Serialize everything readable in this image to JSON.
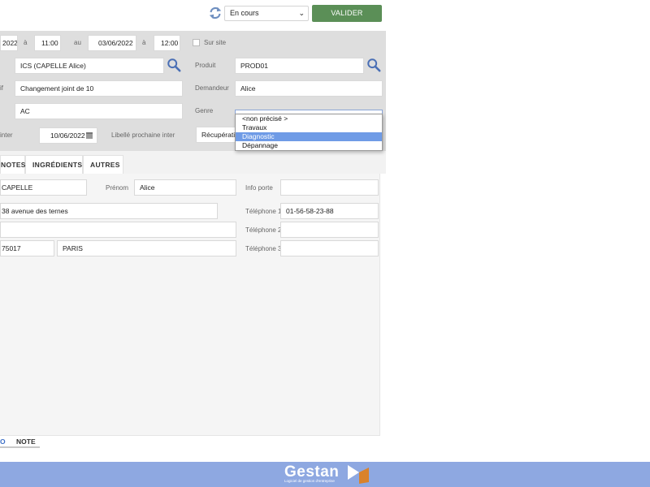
{
  "header": {
    "status_value": "En cours",
    "validate_label": "VALIDER"
  },
  "dates": {
    "start_date": "2022",
    "a1": "à",
    "start_time": "11:00",
    "au": "au",
    "end_date": "03/06/2022",
    "a2": "à",
    "end_time": "12:00",
    "sur_site": "Sur site"
  },
  "form": {
    "client_value": "ICS (CAPELLE Alice)",
    "produit_label": "Produit",
    "produit_value": "PROD01",
    "motif_label": "if",
    "motif_value": "Changement joint de 10",
    "demandeur_label": "Demandeur",
    "demandeur_value": "Alice",
    "ac_value": "AC",
    "genre_label": "Genre",
    "inter_label": "inter",
    "inter_date": "10/06/2022",
    "libelle_label": "Libellé prochaine inter",
    "libelle_value": "Récupération"
  },
  "genre_dropdown": {
    "options": [
      "<non précisé >",
      "Travaux",
      "Diagnostic",
      "Dépannage"
    ],
    "selected": "Diagnostic"
  },
  "tabs": [
    "NOTES",
    "INGRÉDIENTS",
    "AUTRES"
  ],
  "contact": {
    "nom_value": "CAPELLE",
    "prenom_label": "Prénom",
    "prenom_value": "Alice",
    "info_porte_label": "Info porte",
    "address_value": "38 avenue des ternes",
    "tel1_label": "Téléphone 1",
    "tel1_value": "01-56-58-23-88",
    "tel2_label": "Téléphone 2",
    "postcode_value": "75017",
    "city_value": "PARIS",
    "tel3_label": "Téléphone 3"
  },
  "bottom_tabs": [
    "O",
    "NOTE"
  ],
  "footer": {
    "logo_text": "Gestan",
    "logo_tagline": "Logiciel de gestion d'entreprise"
  },
  "colors": {
    "accent_green": "#5b8f57",
    "footer_blue": "#8ea8e1",
    "selected_blue": "#6f9be6",
    "tab_blue": "#3d6fc6",
    "logo_orange": "#d9822b"
  }
}
